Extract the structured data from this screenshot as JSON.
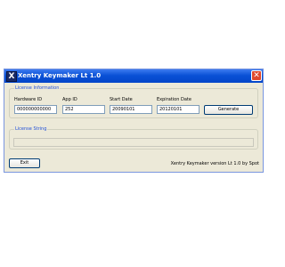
{
  "window": {
    "title": "Xentry Keymaker Lt 1.0",
    "app_icon": "X",
    "close_glyph": "✕"
  },
  "license_info": {
    "legend": "License Information",
    "fields": [
      {
        "label": "Hardware ID",
        "value": "000000000000"
      },
      {
        "label": "App ID",
        "value": "252"
      },
      {
        "label": "Start Date",
        "value": "20090101"
      },
      {
        "label": "Expiration Date",
        "value": "20120101"
      }
    ],
    "generate_label": "Generate"
  },
  "license_string": {
    "legend": "License String",
    "value": ""
  },
  "footer": {
    "exit_label": "Exit",
    "version_text": "Xentry Keymaker version Lt 1.0 by Spot"
  }
}
